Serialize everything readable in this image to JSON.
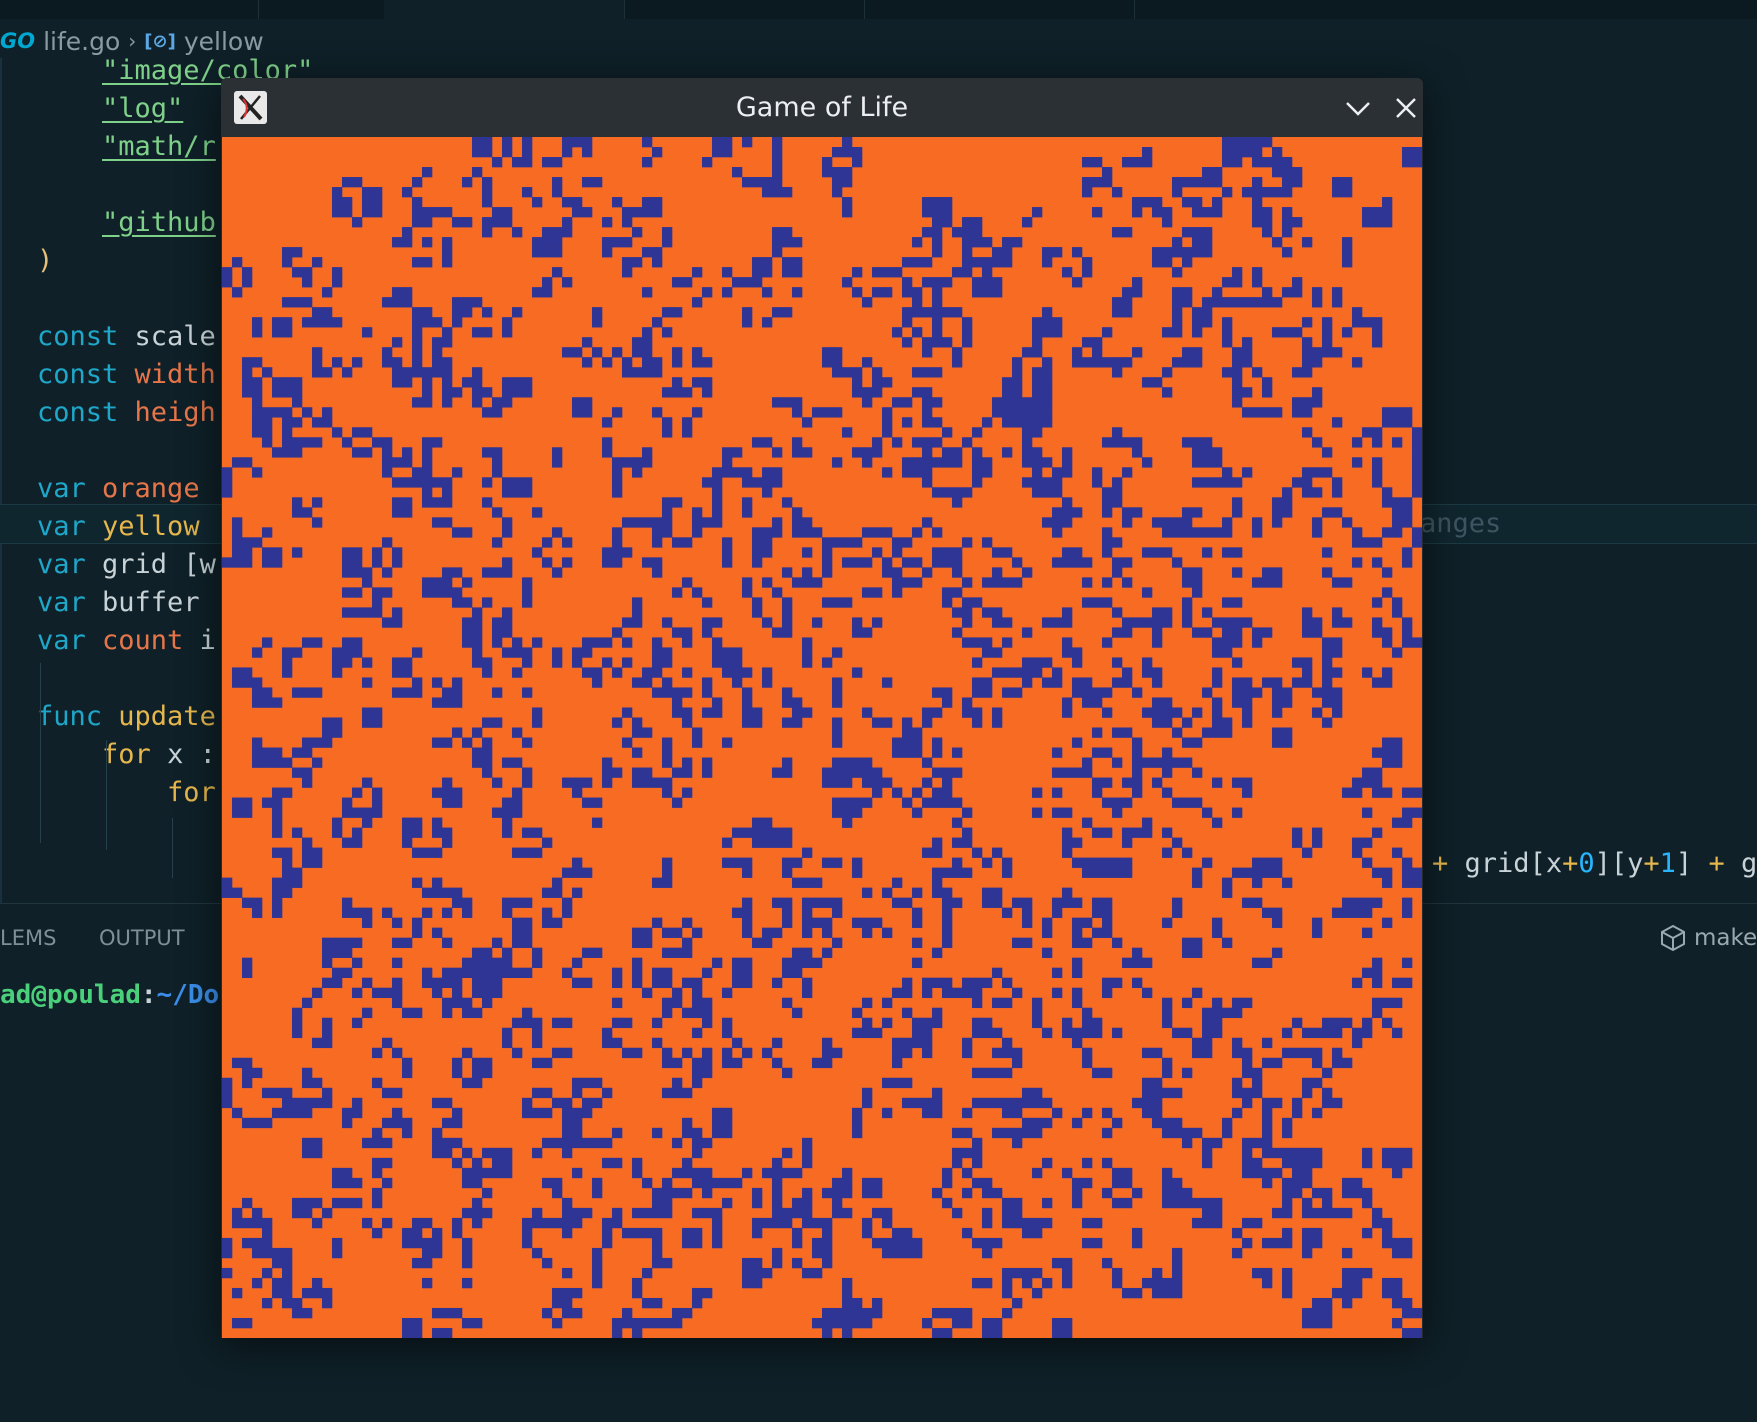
{
  "editor": {
    "breadcrumb": {
      "file_icon": "go-file-icon",
      "file_icon_text": "GO",
      "file": "life.go",
      "symbol_icon": "variable-icon",
      "symbol_icon_text": "[⊘]",
      "symbol": "yellow"
    },
    "lines": [
      {
        "indent": "    ",
        "parts": [
          {
            "c": "str",
            "t": "\"image/color\""
          }
        ]
      },
      {
        "indent": "    ",
        "parts": [
          {
            "c": "str",
            "t": "\"log\""
          }
        ]
      },
      {
        "indent": "    ",
        "parts": [
          {
            "c": "str",
            "t": "\"math/r"
          }
        ]
      },
      {
        "indent": "",
        "parts": []
      },
      {
        "indent": "    ",
        "parts": [
          {
            "c": "str",
            "t": "\"github"
          }
        ]
      },
      {
        "indent": "",
        "parts": [
          {
            "c": "paren",
            "t": ")"
          }
        ]
      },
      {
        "indent": "",
        "parts": []
      },
      {
        "indent": "",
        "parts": [
          {
            "c": "kw",
            "t": "const"
          },
          {
            "c": "plain",
            "t": " scale"
          }
        ]
      },
      {
        "indent": "",
        "parts": [
          {
            "c": "kw",
            "t": "const"
          },
          {
            "c": "id-orange",
            "t": " width"
          }
        ]
      },
      {
        "indent": "",
        "parts": [
          {
            "c": "kw",
            "t": "const"
          },
          {
            "c": "id-orange",
            "t": " heigh"
          }
        ]
      },
      {
        "indent": "",
        "parts": []
      },
      {
        "indent": "",
        "parts": [
          {
            "c": "kw",
            "t": "var"
          },
          {
            "c": "id-orange",
            "t": " orange"
          }
        ]
      },
      {
        "indent": "",
        "parts": [
          {
            "c": "kw",
            "t": "var"
          },
          {
            "c": "id-yellow",
            "t": " yellow"
          }
        ]
      },
      {
        "indent": "",
        "parts": [
          {
            "c": "kw",
            "t": "var"
          },
          {
            "c": "plain",
            "t": " grid [w"
          }
        ]
      },
      {
        "indent": "",
        "parts": [
          {
            "c": "kw",
            "t": "var"
          },
          {
            "c": "plain",
            "t": " buffer"
          }
        ]
      },
      {
        "indent": "",
        "parts": [
          {
            "c": "kw",
            "t": "var"
          },
          {
            "c": "id-orange",
            "t": " count"
          },
          {
            "c": "plain",
            "t": " i"
          }
        ]
      },
      {
        "indent": "",
        "parts": []
      },
      {
        "indent": "",
        "parts": [
          {
            "c": "kw",
            "t": "func"
          },
          {
            "c": "id-yellow",
            "t": " update"
          }
        ]
      },
      {
        "indent": "    ",
        "parts": [
          {
            "c": "id-yellow",
            "t": "for"
          },
          {
            "c": "plain",
            "t": " x :"
          }
        ]
      },
      {
        "indent": "        ",
        "parts": [
          {
            "c": "id-yellow",
            "t": "for"
          }
        ]
      }
    ],
    "ghost_text": "anges",
    "right_code": [
      {
        "c": "id-yellow",
        "t": "+ "
      },
      {
        "c": "plain",
        "t": "grid"
      },
      {
        "c": "plain",
        "t": "["
      },
      {
        "c": "plain",
        "t": "x"
      },
      {
        "c": "id-yellow",
        "t": "+"
      },
      {
        "c": "num",
        "t": "0"
      },
      {
        "c": "plain",
        "t": "]["
      },
      {
        "c": "plain",
        "t": "y"
      },
      {
        "c": "id-yellow",
        "t": "+"
      },
      {
        "c": "num",
        "t": "1"
      },
      {
        "c": "plain",
        "t": "] "
      },
      {
        "c": "id-yellow",
        "t": "+ "
      },
      {
        "c": "plain",
        "t": "g"
      }
    ]
  },
  "panel": {
    "tabs": [
      "LEMS",
      "OUTPUT"
    ],
    "task_label": "make",
    "task_icon": "package-icon",
    "terminal_user": "ad@poulad",
    "terminal_sep": ":",
    "terminal_path": "~/Do"
  },
  "window": {
    "title": "Game of Life",
    "app_icon": "x11-app-icon",
    "minimize_icon": "chevron-down-icon",
    "close_icon": "close-icon"
  },
  "grid": {
    "cols": 120,
    "rows": 120,
    "dead_color": "#f76b22",
    "live_color": "#2e3595",
    "live_density": 0.14,
    "seed": 1234
  }
}
